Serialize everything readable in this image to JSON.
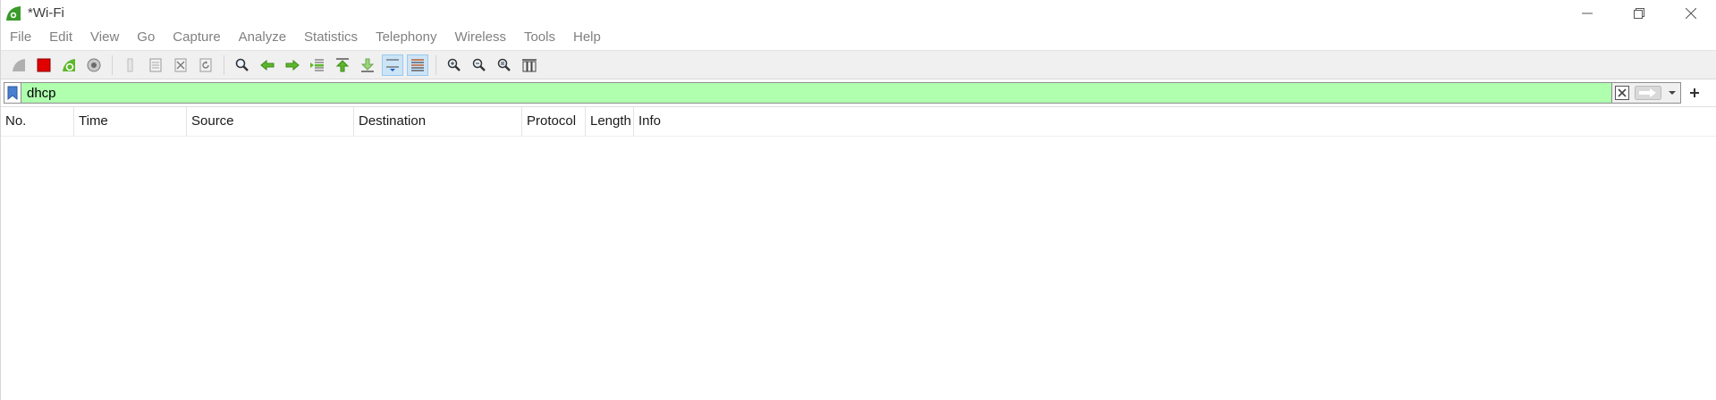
{
  "window": {
    "title": "*Wi-Fi"
  },
  "menu": {
    "items": [
      "File",
      "Edit",
      "View",
      "Go",
      "Capture",
      "Analyze",
      "Statistics",
      "Telephony",
      "Wireless",
      "Tools",
      "Help"
    ]
  },
  "toolbar": {
    "buttons": [
      "start-capture-icon",
      "stop-capture-icon",
      "restart-capture-icon",
      "capture-options-icon",
      "open-file-icon",
      "save-file-icon",
      "close-file-icon",
      "reload-file-icon",
      "find-packet-icon",
      "go-back-icon",
      "go-forward-icon",
      "go-to-packet-icon",
      "first-packet-icon",
      "last-packet-icon",
      "auto-scroll-icon",
      "colorize-icon",
      "zoom-in-icon",
      "zoom-out-icon",
      "normal-size-icon",
      "resize-columns-icon"
    ],
    "active": [
      "auto-scroll-icon",
      "colorize-icon"
    ]
  },
  "filter": {
    "value": "dhcp",
    "background": "#afffaf"
  },
  "packet_list": {
    "columns": [
      "No.",
      "Time",
      "Source",
      "Destination",
      "Protocol",
      "Length",
      "Info"
    ],
    "rows": []
  },
  "colors": {
    "stop_red": "#e00000",
    "toolbar_green": "#5cb82a",
    "menu_text": "#808080"
  }
}
